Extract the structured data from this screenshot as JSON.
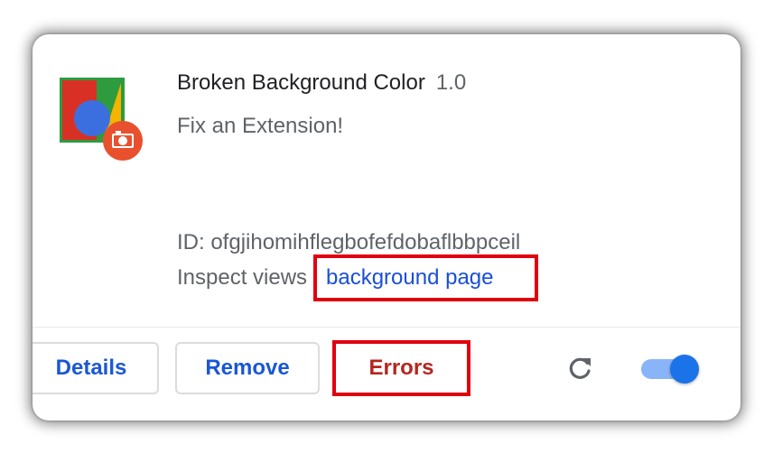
{
  "extension": {
    "name": "Broken Background Color",
    "version": "1.0",
    "description": "Fix an Extension!",
    "id_text": "ID: ofgjihomihflegbofefdobaflbbpceil",
    "inspect_label": "Inspect views",
    "inspect_link": "background page",
    "icon": "extension-logo-icon",
    "badge_icon": "camera-badge-icon"
  },
  "actions": {
    "details_label": "Details",
    "remove_label": "Remove",
    "errors_label": "Errors",
    "reload_icon": "reload-icon",
    "enabled": true
  },
  "colors": {
    "link": "#1a4fd6",
    "button_text": "#1a57d6",
    "errors_text": "#b3261e",
    "highlight": "#e0000f",
    "toggle_on": "#1a73e8"
  }
}
